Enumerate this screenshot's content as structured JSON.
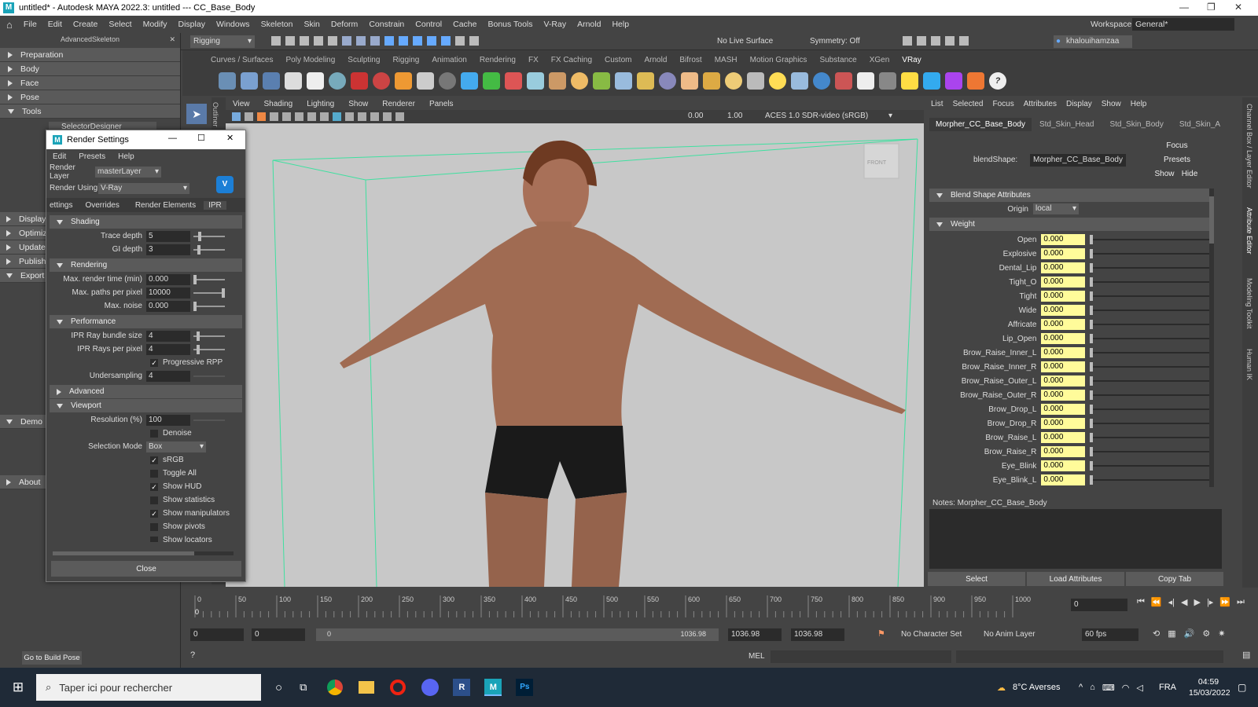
{
  "window": {
    "title": "untitled* - Autodesk MAYA 2022.3: untitled  ---  CC_Base_Body"
  },
  "menubar": {
    "items": [
      "File",
      "Edit",
      "Create",
      "Select",
      "Modify",
      "Display",
      "Windows",
      "Skeleton",
      "Skin",
      "Deform",
      "Constrain",
      "Control",
      "Cache",
      "Bonus Tools",
      "V-Ray",
      "Arnold",
      "Help"
    ],
    "workspace_label": "Workspace:",
    "workspace_value": "General*"
  },
  "statusline": {
    "mode": "Rigging",
    "live_surface": "No Live Surface",
    "symmetry": "Symmetry: Off",
    "user": "khalouihamzaa"
  },
  "shelf": {
    "tabs": [
      "Curves / Surfaces",
      "Poly Modeling",
      "Sculpting",
      "Rigging",
      "Animation",
      "Rendering",
      "FX",
      "FX Caching",
      "Custom",
      "Arnold",
      "Bifrost",
      "MASH",
      "Motion Graphics",
      "Substance",
      "XGen",
      "VRay"
    ],
    "active_tab": "VRay"
  },
  "left_panel": {
    "header": "AdvancedSkeleton",
    "sections": [
      "Preparation",
      "Body",
      "Face",
      "Pose",
      "Tools"
    ],
    "tool_item": "SelectorDesigner",
    "lower_sections": [
      "Display",
      "Optimiz",
      "Update",
      "Publish",
      "Export"
    ],
    "demo": "Demo",
    "about": "About",
    "go_build_pose": "Go to Build Pose"
  },
  "render_settings": {
    "title": "Render Settings",
    "menu": [
      "Edit",
      "Presets",
      "Help"
    ],
    "render_layer_label": "Render Layer",
    "render_layer_value": "masterLayer",
    "render_using_label": "Render Using",
    "render_using_value": "V-Ray",
    "tabs": [
      "ettings",
      "Overrides",
      "Render Elements",
      "IPR"
    ],
    "shading": {
      "title": "Shading",
      "trace_depth_label": "Trace depth",
      "trace_depth": "5",
      "gi_depth_label": "GI depth",
      "gi_depth": "3"
    },
    "rendering": {
      "title": "Rendering",
      "max_time_label": "Max. render time (min)",
      "max_time": "0.000",
      "max_paths_label": "Max. paths per pixel",
      "max_paths": "10000",
      "max_noise_label": "Max. noise",
      "max_noise": "0.000"
    },
    "performance": {
      "title": "Performance",
      "bundle_label": "IPR Ray bundle size",
      "bundle": "4",
      "rays_label": "IPR Rays per pixel",
      "rays": "4",
      "progressive": "Progressive RPP",
      "undersampling_label": "Undersampling",
      "undersampling": "4"
    },
    "advanced": "Advanced",
    "viewport": {
      "title": "Viewport",
      "resolution_label": "Resolution (%)",
      "resolution": "100",
      "denoise": "Denoise",
      "selection_mode_label": "Selection Mode",
      "selection_mode": "Box",
      "srgb": "sRGB",
      "toggle_all": "Toggle All",
      "show_hud": "Show HUD",
      "show_statistics": "Show statistics",
      "show_manipulators": "Show manipulators",
      "show_pivots": "Show pivots",
      "show_locators": "Show locators"
    },
    "close": "Close"
  },
  "viewport": {
    "menu": [
      "View",
      "Shading",
      "Lighting",
      "Show",
      "Renderer",
      "Panels"
    ],
    "field1": "0.00",
    "field2": "1.00",
    "color_space": "ACES 1.0 SDR-video (sRGB)",
    "outliner_label": "Outliner",
    "viewcube_label": "FRONT"
  },
  "attribute_editor": {
    "menu": [
      "List",
      "Selected",
      "Focus",
      "Attributes",
      "Display",
      "Show",
      "Help"
    ],
    "tabs": [
      "Morpher_CC_Base_Body",
      "Std_Skin_Head",
      "Std_Skin_Body",
      "Std_Skin_A"
    ],
    "blendshape_label": "blendShape:",
    "blendshape_value": "Morpher_CC_Base_Body",
    "focus": "Focus",
    "presets": "Presets",
    "show": "Show",
    "hide": "Hide",
    "section": "Blend Shape Attributes",
    "origin_label": "Origin",
    "origin_value": "local",
    "weight_section": "Weight",
    "weights": [
      {
        "name": "Open",
        "value": "0.000"
      },
      {
        "name": "Explosive",
        "value": "0.000"
      },
      {
        "name": "Dental_Lip",
        "value": "0.000"
      },
      {
        "name": "Tight_O",
        "value": "0.000"
      },
      {
        "name": "Tight",
        "value": "0.000"
      },
      {
        "name": "Wide",
        "value": "0.000"
      },
      {
        "name": "Affricate",
        "value": "0.000"
      },
      {
        "name": "Lip_Open",
        "value": "0.000"
      },
      {
        "name": "Brow_Raise_Inner_L",
        "value": "0.000"
      },
      {
        "name": "Brow_Raise_Inner_R",
        "value": "0.000"
      },
      {
        "name": "Brow_Raise_Outer_L",
        "value": "0.000"
      },
      {
        "name": "Brow_Raise_Outer_R",
        "value": "0.000"
      },
      {
        "name": "Brow_Drop_L",
        "value": "0.000"
      },
      {
        "name": "Brow_Drop_R",
        "value": "0.000"
      },
      {
        "name": "Brow_Raise_L",
        "value": "0.000"
      },
      {
        "name": "Brow_Raise_R",
        "value": "0.000"
      },
      {
        "name": "Eye_Blink",
        "value": "0.000"
      },
      {
        "name": "Eye_Blink_L",
        "value": "0.000"
      }
    ],
    "notes_label": "Notes:  Morpher_CC_Base_Body",
    "select_btn": "Select",
    "load_btn": "Load Attributes",
    "copy_btn": "Copy Tab",
    "side_tabs": [
      "Channel Box / Layer Editor",
      "Attribute Editor",
      "Modeling Toolkit",
      "Human IK"
    ]
  },
  "timeline": {
    "ticks": [
      "0",
      "50",
      "100",
      "150",
      "200",
      "250",
      "300",
      "350",
      "400",
      "450",
      "500",
      "550",
      "600",
      "650",
      "700",
      "750",
      "800",
      "850",
      "900",
      "950",
      "1000"
    ],
    "current_frame": "0",
    "start": "0",
    "range_start": "0",
    "range_handle_start": "0",
    "range_handle_end": "1036.98",
    "end": "1036.98",
    "end2": "1036.98",
    "character_set": "No Character Set",
    "anim_layer": "No Anim Layer",
    "fps": "60 fps"
  },
  "command_line": {
    "label": "MEL"
  },
  "taskbar": {
    "search_placeholder": "Taper ici pour rechercher",
    "weather": "8°C  Averses",
    "lang": "FRA",
    "time": "04:59",
    "date": "15/03/2022"
  }
}
